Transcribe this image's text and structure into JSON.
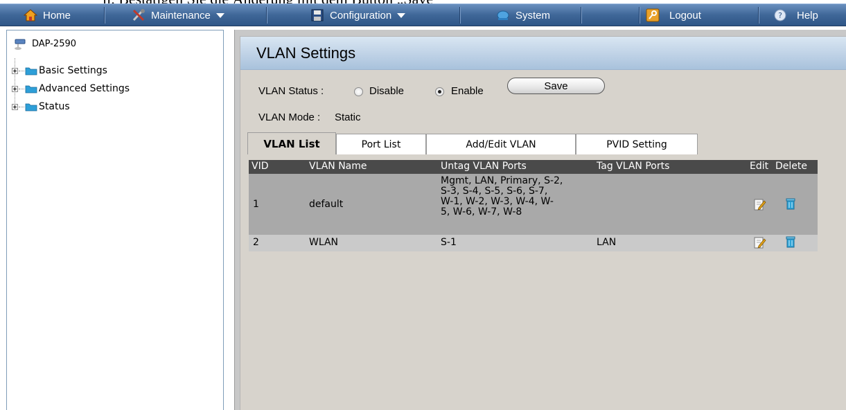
{
  "doc_caption": "ii.   Bestätigen Sie die Änderung mit dem Button „Save“",
  "nav": {
    "home": "Home",
    "maintenance": "Maintenance",
    "configuration": "Configuration",
    "system": "System",
    "logout": "Logout",
    "help": "Help"
  },
  "tree": {
    "root": "DAP-2590",
    "items": [
      {
        "label": "Basic Settings",
        "icon": "folder-icon"
      },
      {
        "label": "Advanced Settings",
        "icon": "folder-icon"
      },
      {
        "label": "Status",
        "icon": "folder-icon"
      }
    ]
  },
  "panel": {
    "title": "VLAN Settings",
    "status_label": "VLAN Status :",
    "disable_label": "Disable",
    "enable_label": "Enable",
    "status_value": "Enable",
    "save_label": "Save",
    "mode_label": "VLAN Mode :",
    "mode_value": "Static"
  },
  "tabs": [
    "VLAN List",
    "Port List",
    "Add/Edit VLAN",
    "PVID Setting"
  ],
  "active_tab": "VLAN List",
  "table": {
    "columns": [
      "VID",
      "VLAN Name",
      "Untag VLAN Ports",
      "Tag VLAN Ports",
      "Edit",
      "Delete"
    ],
    "rows": [
      {
        "vid": "1",
        "name": "default",
        "untag": "Mgmt, LAN, Primary, S-2,\nS-3, S-4, S-5, S-6, S-7,\nW-1, W-2, W-3, W-4, W-\n5, W-6, W-7, W-8",
        "tag": ""
      },
      {
        "vid": "2",
        "name": "WLAN",
        "untag": "S-1",
        "tag": "LAN"
      }
    ]
  },
  "colors": {
    "nav_bar": "#3f6798",
    "header_gradient": "#bcd0e5",
    "table_header": "#4a4a4a",
    "row_dark": "#a9a9a9",
    "row_light": "#cacaca",
    "panel_bg": "#d7d3cc"
  }
}
